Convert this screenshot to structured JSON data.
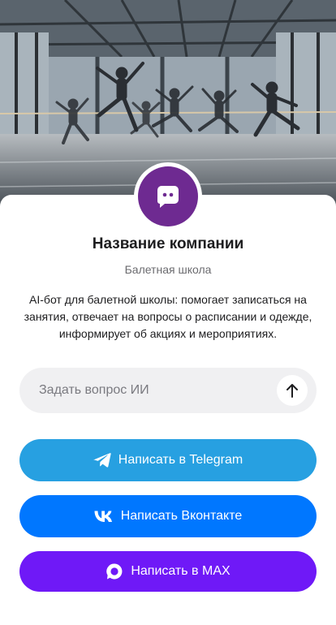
{
  "hero": {
    "image": "ballet-studio-photo"
  },
  "company": {
    "avatar_icon": "chat-bubble-icon",
    "avatar_color": "#6e2a91",
    "name": "Название компании",
    "category": "Балетная школа",
    "description": "AI-бот для балетной школы: помогает записаться на занятия, отвечает на вопросы о расписании и одежде, информирует об акциях и мероприятиях."
  },
  "ask": {
    "placeholder": "Задать вопрос ИИ",
    "value": "",
    "send_icon": "arrow-up-icon"
  },
  "buttons": {
    "telegram": {
      "label": "Написать в Telegram",
      "icon": "telegram-icon",
      "color": "#27a0e1"
    },
    "vk": {
      "label": "Написать Вконтакте",
      "icon": "vk-icon",
      "color": "#0077ff"
    },
    "max": {
      "label": "Написать в MAX",
      "icon": "max-icon",
      "color": "#6f19f7"
    }
  }
}
